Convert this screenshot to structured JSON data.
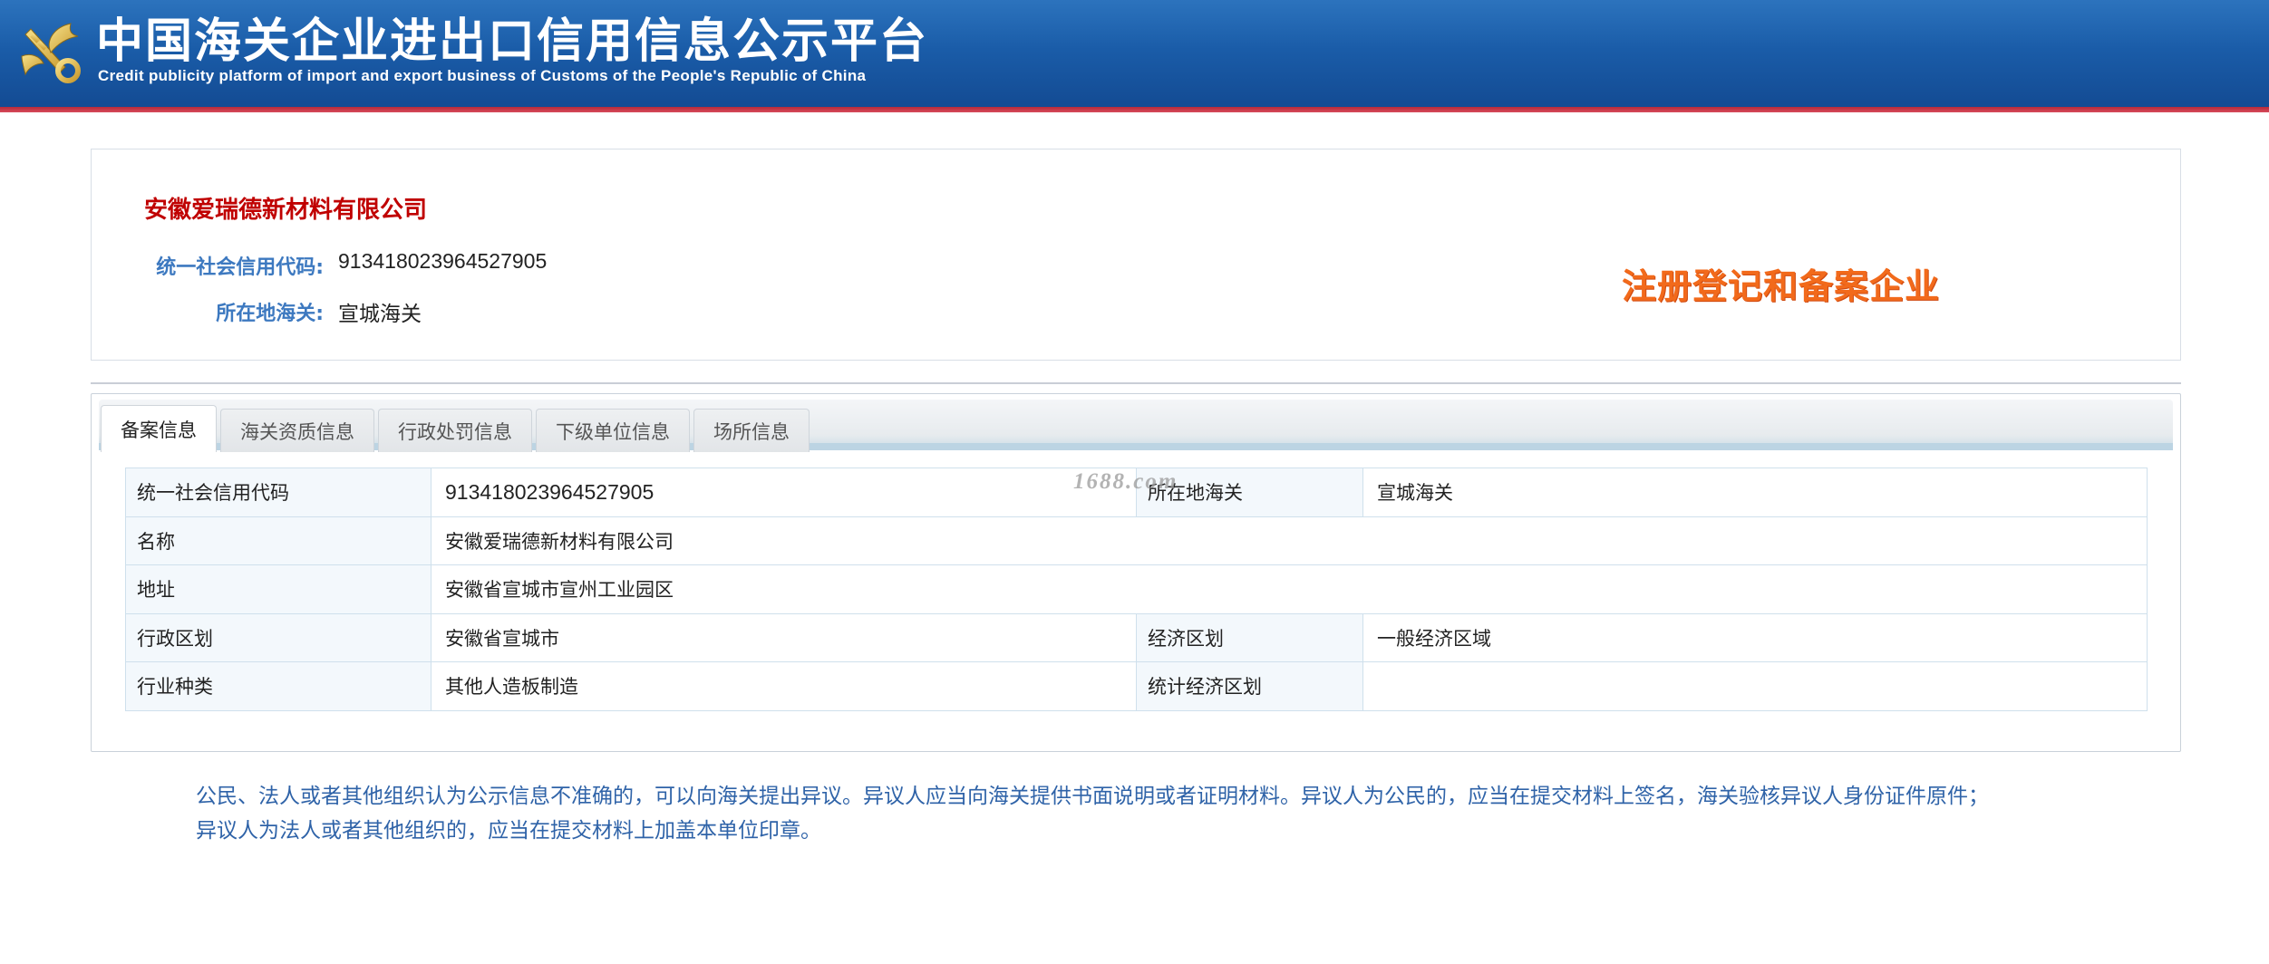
{
  "header": {
    "title_cn": "中国海关企业进出口信用信息公示平台",
    "title_en": "Credit publicity platform of import and export business of Customs of the People's Republic of China",
    "logo_icon": "customs-emblem-icon"
  },
  "company": {
    "name": "安徽爱瑞德新材料有限公司",
    "credit_code_label": "统一社会信用代码:",
    "credit_code": "913418023964527905",
    "customs_label": "所在地海关:",
    "customs": "宣城海关",
    "status_badge": "注册登记和备案企业"
  },
  "tabs": [
    {
      "label": "备案信息",
      "active": true
    },
    {
      "label": "海关资质信息",
      "active": false
    },
    {
      "label": "行政处罚信息",
      "active": false
    },
    {
      "label": "下级单位信息",
      "active": false
    },
    {
      "label": "场所信息",
      "active": false
    }
  ],
  "table": {
    "rows": [
      {
        "l1": "统一社会信用代码",
        "v1": "913418023964527905",
        "l2": "所在地海关",
        "v2": "宣城海关"
      },
      {
        "l1": "名称",
        "v1": "安徽爱瑞德新材料有限公司"
      },
      {
        "l1": "地址",
        "v1": "安徽省宣城市宣州工业园区"
      },
      {
        "l1": "行政区划",
        "v1": "安徽省宣城市",
        "l2": "经济区划",
        "v2": "一般经济区域"
      },
      {
        "l1": "行业种类",
        "v1": "其他人造板制造",
        "l2": "统计经济区划",
        "v2": ""
      }
    ]
  },
  "watermark": "1688.com",
  "notice": {
    "line1": "公民、法人或者其他组织认为公示信息不准确的，可以向海关提出异议。异议人应当向海关提供书面说明或者证明材料。异议人为公民的，应当在提交材料上签名，海关验核异议人身份证件原件；",
    "line2": "异议人为法人或者其他组织的，应当在提交材料上加盖本单位印章。"
  },
  "colors": {
    "header_blue": "#1a5ca8",
    "header_red_strip": "#c83a4a",
    "company_name_red": "#c00000",
    "label_blue": "#3d79c0",
    "badge_orange": "#f26a1b",
    "notice_blue": "#2f63a8"
  }
}
